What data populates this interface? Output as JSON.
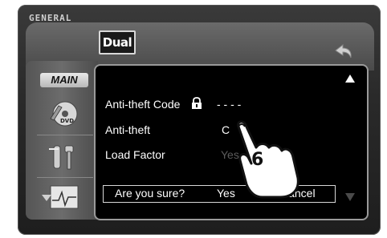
{
  "header": {
    "section_label": "GENERAL",
    "brand": "Dual"
  },
  "sidebar": {
    "main_tab": "MAIN",
    "items": [
      {
        "icon": "dvd-icon"
      },
      {
        "icon": "tools-icon"
      },
      {
        "icon": "chart-icon"
      }
    ]
  },
  "settings": {
    "rows": [
      {
        "label": "Anti-theft  Code",
        "value": "- - - -"
      },
      {
        "label": "Anti-theft",
        "value": "C"
      },
      {
        "label": "Load Factor",
        "value": "Yes"
      }
    ]
  },
  "confirm": {
    "prompt": "Are you sure?",
    "yes_label": "Yes",
    "cancel_label": "Cancel"
  },
  "overlay": {
    "step_number": "6"
  },
  "colors": {
    "screen_bg": "#000000",
    "text": "#ffffff",
    "dim_text": "#5c5c5c",
    "frame": "#2a2a2a"
  }
}
